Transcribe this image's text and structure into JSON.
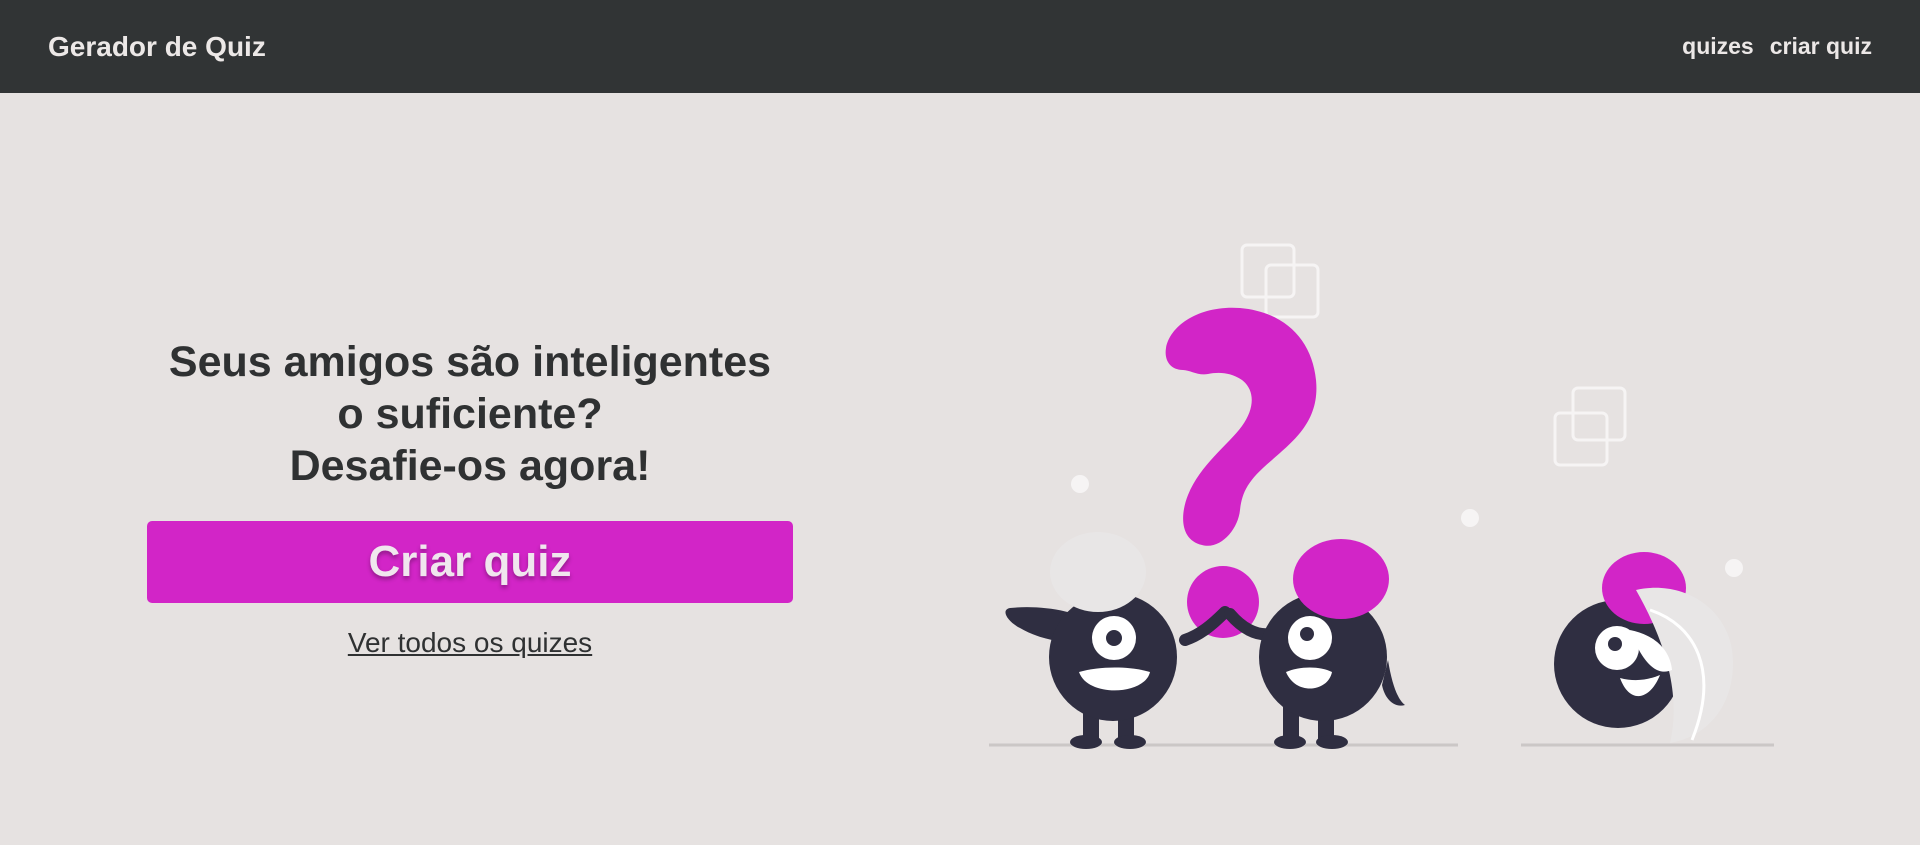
{
  "navbar": {
    "brand": "Gerador de Quiz",
    "links": [
      {
        "label": "quizes"
      },
      {
        "label": "criar quiz"
      }
    ]
  },
  "hero": {
    "headline_lines": [
      "Seus amigos são inteligentes",
      "o suficiente?",
      "Desafie-os agora!"
    ],
    "cta_label": "Criar quiz",
    "secondary_link": "Ver todos os quizes"
  },
  "colors": {
    "navbar_bg": "#313435",
    "page_bg": "#e6e2e1",
    "accent": "#d225c7",
    "text": "#2f3132",
    "character": "#2f2e41"
  },
  "illustration": {
    "icon": "question-mark-characters-illustration"
  }
}
